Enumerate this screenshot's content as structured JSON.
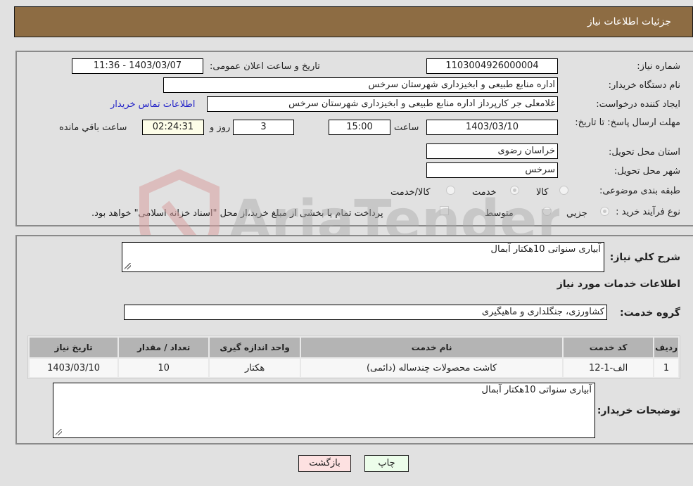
{
  "header": {
    "title": "جزئیات اطلاعات نیاز"
  },
  "form": {
    "need_number": {
      "label": "شماره نیاز:",
      "value": "1103004926000004"
    },
    "announce_datetime": {
      "label": "تاریخ و ساعت اعلان عمومی:",
      "value": "1403/03/07 - 11:36"
    },
    "buyer_org": {
      "label": "نام دستگاه خریدار:",
      "value": "اداره منابع طبیعی و ابخیزداری شهرستان سرخس"
    },
    "requester": {
      "label": "ایجاد کننده درخواست:",
      "value": "غلامعلی جر کارپرداز اداره منابع طبیعی و ابخیزداری شهرستان سرخس"
    },
    "buyer_contact_link": "اطلاعات تماس خریدار",
    "deadline": {
      "label": "مهلت ارسال پاسخ: تا تاریخ:",
      "date": "1403/03/10",
      "time_label": "ساعت",
      "time": "15:00",
      "days": "3",
      "days_label": "روز و",
      "remaining": "02:24:31",
      "remaining_label": "ساعت باقي مانده"
    },
    "province": {
      "label": "استان محل تحویل:",
      "value": "خراسان رضوی"
    },
    "city": {
      "label": "شهر محل تحویل:",
      "value": "سرخس"
    },
    "category": {
      "label": "طبقه بندی موضوعی:",
      "options": [
        "کالا",
        "خدمت",
        "کالا/خدمت"
      ],
      "selected": "خدمت"
    },
    "purchase_type": {
      "label": "نوع فرآیند خرید :",
      "options": [
        "جزيي",
        "متوسط"
      ],
      "selected": "جزيي",
      "treasury_note": "پرداخت تمام یا بخشی از مبلغ خرید،از محل \"اسناد خزانه اسلامی\" خواهد بود.",
      "treasury_checked": false
    }
  },
  "details": {
    "general_desc_label": "شرح کلي نیاز:",
    "general_desc": "آبیاری سنواتی 10هکتار آبمال",
    "services_heading": "اطلاعات خدمات مورد نیاز",
    "service_group_label": "گروه خدمت:",
    "service_group": "کشاورزی، جنگلداری و ماهیگیری",
    "table": {
      "headers": [
        "ردیف",
        "کد خدمت",
        "نام خدمت",
        "واحد اندازه گیری",
        "تعداد / مقدار",
        "تاریخ نیاز"
      ],
      "rows": [
        [
          "1",
          "الف-1-12",
          "کاشت محصولات چندساله (دائمی)",
          "هکتار",
          "10",
          "1403/03/10"
        ]
      ]
    },
    "buyer_notes_label": "توضیحات خریدار:",
    "buyer_notes": "آبیاری سنواتی 10هکتار آبمال"
  },
  "buttons": {
    "print": "چاپ",
    "back": "بازگشت"
  },
  "watermark": "AriaTender.neT"
}
